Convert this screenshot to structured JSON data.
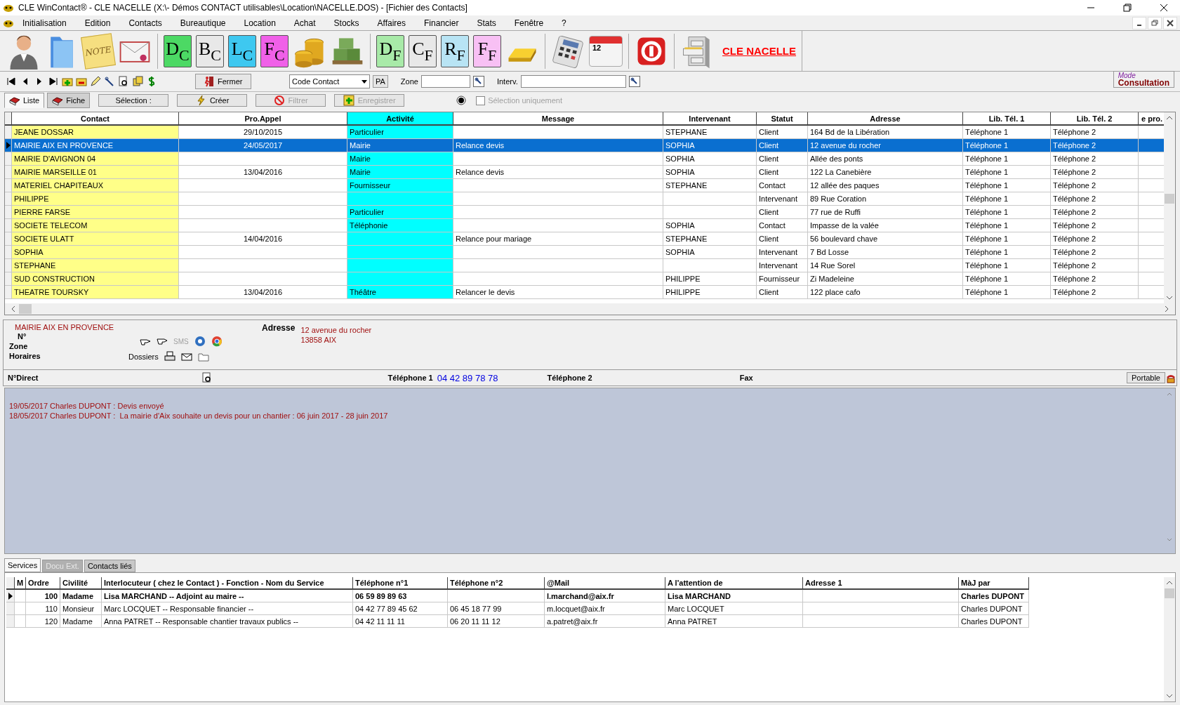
{
  "window": {
    "title": "CLE WinContact® - CLE NACELLE (X:\\- Démos CONTACT utilisables\\Location\\NACELLE.DOS) - [Fichier des Contacts]"
  },
  "menu": [
    "Initialisation",
    "Edition",
    "Contacts",
    "Bureautique",
    "Location",
    "Achat",
    "Stocks",
    "Affaires",
    "Financier",
    "Stats",
    "Fenêtre",
    "?"
  ],
  "toolbar": [
    {
      "kind": "person"
    },
    {
      "kind": "folder"
    },
    {
      "kind": "note",
      "text": "NOTE"
    },
    {
      "kind": "mail"
    },
    {
      "kind": "sep"
    },
    {
      "kind": "doc",
      "big": "D",
      "small": "C",
      "color": "#4cd964"
    },
    {
      "kind": "doc",
      "big": "B",
      "small": "C",
      "color": "#e8e8e8"
    },
    {
      "kind": "doc",
      "big": "L",
      "small": "C",
      "color": "#3ec8f0"
    },
    {
      "kind": "doc",
      "big": "F",
      "small": "C",
      "color": "#f060e8"
    },
    {
      "kind": "coins"
    },
    {
      "kind": "boxes"
    },
    {
      "kind": "sep"
    },
    {
      "kind": "doc",
      "big": "D",
      "small": "F",
      "color": "#a8eaa8"
    },
    {
      "kind": "doc",
      "big": "C",
      "small": "F",
      "color": "#e8e8e8"
    },
    {
      "kind": "doc",
      "big": "R",
      "small": "F",
      "color": "#b8e4f4"
    },
    {
      "kind": "doc",
      "big": "F",
      "small": "F",
      "color": "#f8c0f4"
    },
    {
      "kind": "gold"
    },
    {
      "kind": "sep"
    },
    {
      "kind": "calc"
    },
    {
      "kind": "calendar",
      "text": "12"
    },
    {
      "kind": "sep"
    },
    {
      "kind": "power"
    },
    {
      "kind": "sep"
    },
    {
      "kind": "cabinet"
    }
  ],
  "company_link": "CLE NACELLE",
  "nav": {
    "close_button": "Fermer",
    "sort_select": "Code Contact",
    "pa_button": "PA",
    "zone_label": "Zone",
    "interv_label": "Interv.",
    "mode_legend": "Mode",
    "mode_value": "Consultation"
  },
  "view_tabs": [
    {
      "label": "Liste",
      "selected": true
    },
    {
      "label": "Fiche",
      "selected": false
    }
  ],
  "actions": [
    {
      "label": "Sélection :",
      "kind": "plain",
      "disabled": false
    },
    {
      "label": "Créer",
      "kind": "bolt",
      "disabled": false
    },
    {
      "label": "Filtrer",
      "kind": "forbid",
      "disabled": true
    },
    {
      "label": "Enregistrer",
      "kind": "plus",
      "disabled": true
    }
  ],
  "selection_only": {
    "label": "Sélection uniquement",
    "checked": false,
    "disabled": true
  },
  "grid": {
    "columns": [
      "Contact",
      "Pro.Appel",
      "Activité",
      "Message",
      "Intervenant",
      "Statut",
      "Adresse",
      "Lib. Tél. 1",
      "Lib. Tél. 2",
      "e pro."
    ],
    "rows": [
      {
        "contact": "JEANE DOSSAR",
        "pro_appel": "29/10/2015",
        "activite": "Particulier",
        "message": "",
        "intervenant": "STEPHANE",
        "statut": "Client",
        "adresse": "164 Bd de la Libération",
        "tel1": "Téléphone 1",
        "tel2": "Téléphone 2",
        "selected": false
      },
      {
        "contact": "MAIRIE AIX EN PROVENCE",
        "pro_appel": "24/05/2017",
        "activite": "Mairie",
        "message": "Relance devis",
        "intervenant": "SOPHIA",
        "statut": "Client",
        "adresse": "12 avenue du rocher",
        "tel1": "Téléphone 1",
        "tel2": "Téléphone 2",
        "selected": true
      },
      {
        "contact": "MAIRIE D'AVIGNON 04",
        "pro_appel": "",
        "activite": "Mairie",
        "message": "",
        "intervenant": "SOPHIA",
        "statut": "Client",
        "adresse": "Allée des ponts",
        "tel1": "Téléphone 1",
        "tel2": "Téléphone 2",
        "selected": false
      },
      {
        "contact": "MAIRIE MARSEILLE 01",
        "pro_appel": "13/04/2016",
        "activite": "Mairie",
        "message": "Relance devis",
        "intervenant": "SOPHIA",
        "statut": "Client",
        "adresse": "122 La Canebière",
        "tel1": "Téléphone 1",
        "tel2": "Téléphone 2",
        "selected": false
      },
      {
        "contact": "MATERIEL CHAPITEAUX",
        "pro_appel": "",
        "activite": "Fournisseur",
        "message": "",
        "intervenant": "STEPHANE",
        "statut": "Contact",
        "adresse": "12 allée des paques",
        "tel1": "Téléphone 1",
        "tel2": "Téléphone 2",
        "selected": false
      },
      {
        "contact": "PHILIPPE",
        "pro_appel": "",
        "activite": "",
        "message": "",
        "intervenant": "",
        "statut": "Intervenant",
        "adresse": "89 Rue Coration",
        "tel1": "Téléphone 1",
        "tel2": "Téléphone 2",
        "selected": false
      },
      {
        "contact": "PIERRE FARSE",
        "pro_appel": "",
        "activite": "Particulier",
        "message": "",
        "intervenant": "",
        "statut": "Client",
        "adresse": "77 rue de Ruffi",
        "tel1": "Téléphone 1",
        "tel2": "Téléphone 2",
        "selected": false
      },
      {
        "contact": "SOCIETE TELECOM",
        "pro_appel": "",
        "activite": "Téléphonie",
        "message": "",
        "intervenant": "SOPHIA",
        "statut": "Contact",
        "adresse": "Impasse de la valée",
        "tel1": "Téléphone 1",
        "tel2": "Téléphone 2",
        "selected": false
      },
      {
        "contact": "SOCIETE ULATT",
        "pro_appel": "14/04/2016",
        "activite": "",
        "message": "Relance pour mariage",
        "intervenant": "STEPHANE",
        "statut": "Client",
        "adresse": "56 boulevard chave",
        "tel1": "Téléphone 1",
        "tel2": "Téléphone 2",
        "selected": false
      },
      {
        "contact": "SOPHIA",
        "pro_appel": "",
        "activite": "",
        "message": "",
        "intervenant": "SOPHIA",
        "statut": "Intervenant",
        "adresse": "7 Bd Losse",
        "tel1": "Téléphone 1",
        "tel2": "Téléphone 2",
        "selected": false
      },
      {
        "contact": "STEPHANE",
        "pro_appel": "",
        "activite": "",
        "message": "",
        "intervenant": "",
        "statut": "Intervenant",
        "adresse": "14 Rue Sorel",
        "tel1": "Téléphone 1",
        "tel2": "Téléphone 2",
        "selected": false
      },
      {
        "contact": "SUD CONSTRUCTION",
        "pro_appel": "",
        "activite": "",
        "message": "",
        "intervenant": "PHILIPPE",
        "statut": "Fournisseur",
        "adresse": "Zi Madeleine",
        "tel1": "Téléphone 1",
        "tel2": "Téléphone 2",
        "selected": false
      },
      {
        "contact": "THEATRE TOURSKY",
        "pro_appel": "13/04/2016",
        "activite": "Théâtre",
        "message": "Relancer le devis",
        "intervenant": "PHILIPPE",
        "statut": "Client",
        "adresse": "122 place cafo",
        "tel1": "Téléphone 1",
        "tel2": "Téléphone 2",
        "selected": false
      }
    ]
  },
  "detail": {
    "name": "MAIRIE AIX EN PROVENCE",
    "labels": [
      "N°",
      "Zone",
      "Horaires"
    ],
    "sms": "SMS",
    "dossiers": "Dossiers",
    "address_label": "Adresse",
    "address_lines": [
      "12 avenue du rocher",
      "13858 AIX"
    ]
  },
  "phones": {
    "direct_label": "N°Direct",
    "tel1_label": "Téléphone 1",
    "tel1_value": "04 42 89 78 78",
    "tel2_label": "Téléphone 2",
    "fax_label": "Fax",
    "mobile_button": "Portable"
  },
  "notes": [
    "19/05/2017 Charles DUPONT : Devis envoyé",
    "18/05/2017 Charles DUPONT :  La mairie d'Aix souhaite un devis pour un chantier : 06 juin 2017 - 28 juin 2017"
  ],
  "bottom_tabs": [
    {
      "label": "Services",
      "selected": true,
      "disabled": false
    },
    {
      "label": "Docu Ext.",
      "selected": false,
      "disabled": true
    },
    {
      "label": "Contacts liés",
      "selected": false,
      "disabled": false
    }
  ],
  "services": {
    "columns": [
      "M",
      "Ordre",
      "Civilité",
      "Interlocuteur ( chez le Contact ) - Fonction - Nom du Service",
      "Téléphone n°1",
      "Téléphone n°2",
      "@Mail",
      "A l'attention de",
      "Adresse 1",
      "MàJ par"
    ],
    "rows": [
      {
        "ordre": "100",
        "civilite": "Madame",
        "interlocuteur": "Lisa MARCHAND -- Adjoint au maire --",
        "tel1": "06 59 89 89 63",
        "tel2": "",
        "mail": "l.marchand@aix.fr",
        "attention": "Lisa MARCHAND",
        "maj": "Charles DUPONT",
        "selected": true
      },
      {
        "ordre": "110",
        "civilite": "Monsieur",
        "interlocuteur": "Marc LOCQUET -- Responsable financier --",
        "tel1": "04 42 77 89 45 62",
        "tel2": "06 45 18 77 99",
        "mail": "m.locquet@aix.fr",
        "attention": "Marc LOCQUET",
        "maj": "Charles DUPONT",
        "selected": false
      },
      {
        "ordre": "120",
        "civilite": "Madame",
        "interlocuteur": "Anna PATRET -- Responsable chantier travaux publics --",
        "tel1": "04 42 11 11 11",
        "tel2": "06 20 11 11 12",
        "mail": "a.patret@aix.fr",
        "attention": "Anna PATRET",
        "maj": "Charles DUPONT",
        "selected": false
      }
    ]
  }
}
